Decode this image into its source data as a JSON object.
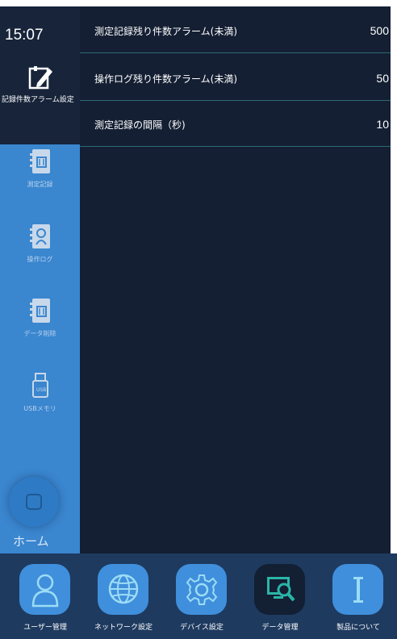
{
  "status": {
    "time": "15:07"
  },
  "sidebar": {
    "selected": {
      "label": "記録件数アラーム設定",
      "icon": "edit-note-icon"
    },
    "items": [
      {
        "label": "測定記録",
        "icon": "notebook-icon"
      },
      {
        "label": "操作ログ",
        "icon": "user-notebook-icon"
      },
      {
        "label": "データ削除",
        "icon": "notebook-delete-icon"
      },
      {
        "label": "USBメモリ",
        "icon": "usb-icon"
      }
    ],
    "home": {
      "label": "ホーム",
      "icon": "home-icon"
    }
  },
  "settings": [
    {
      "label": "測定記録残り件数アラーム(未満)",
      "value": "500"
    },
    {
      "label": "操作ログ残り件数アラーム(未満)",
      "value": "50"
    },
    {
      "label": "測定記録の間隔（秒)",
      "value": "10"
    }
  ],
  "bottom_nav": [
    {
      "label": "ユーザー管理",
      "icon": "user-icon",
      "active": false
    },
    {
      "label": "ネットワーク設定",
      "icon": "globe-icon",
      "active": false
    },
    {
      "label": "デバイス設定",
      "icon": "gear-icon",
      "active": false
    },
    {
      "label": "データ管理",
      "icon": "monitor-search-icon",
      "active": true
    },
    {
      "label": "製品について",
      "icon": "info-icon",
      "active": false
    }
  ],
  "colors": {
    "sidebar": "#3a86cf",
    "panel": "#141f33",
    "bottom_bar": "#1e3a5f",
    "tile": "#3f8fdc",
    "divider": "#2c6a73"
  }
}
